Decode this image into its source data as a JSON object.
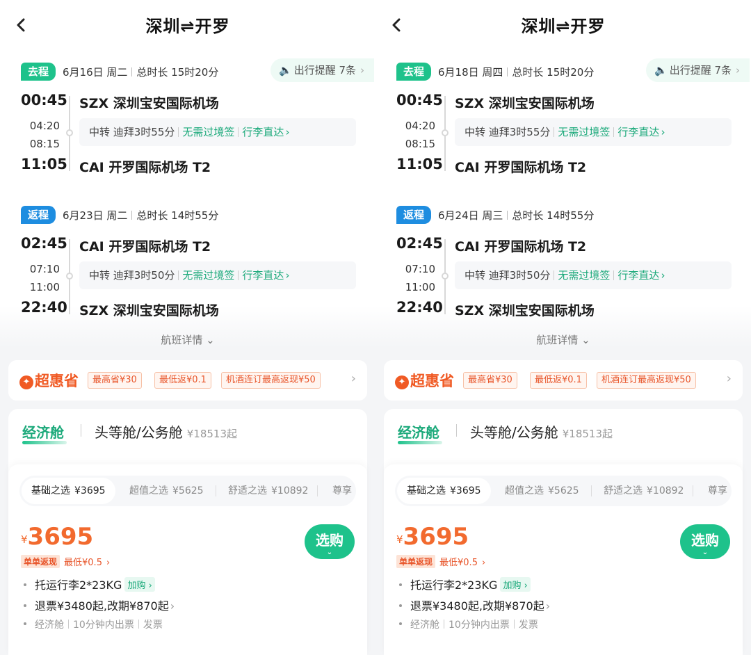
{
  "screens": [
    {
      "title": "深圳⇌开罗",
      "outbound": {
        "tag": "去程",
        "date": "6月16日 周二",
        "duration": "总时长 15时20分",
        "reminder": "出行提醒 7条",
        "dep_time": "00:45",
        "mid_arr": "04:20",
        "mid_dep": "08:15",
        "arr_time": "11:05",
        "dep_airport": "SZX 深圳宝安国际机场",
        "arr_airport": "CAI 开罗国际机场 T2",
        "transfer": "中转 迪拜3时55分",
        "visa": "无需过境签",
        "baggage": "行李直达"
      },
      "return": {
        "tag": "返程",
        "date": "6月23日 周二",
        "duration": "总时长 14时55分",
        "dep_time": "02:45",
        "mid_arr": "07:10",
        "mid_dep": "11:00",
        "arr_time": "22:40",
        "dep_airport": "CAI 开罗国际机场 T2",
        "arr_airport": "SZX 深圳宝安国际机场",
        "transfer": "中转 迪拜3时50分",
        "visa": "无需过境签",
        "baggage": "行李直达"
      },
      "flight_detail": "航班详情",
      "promo": {
        "brand": "超惠省",
        "chips": [
          "最高省¥30",
          "最低返¥0.1",
          "机酒连订最高返现¥50"
        ]
      },
      "cabin_tabs": {
        "economy": "经济舱",
        "business": "头等舱/公务舱",
        "business_price": "¥18513起"
      },
      "fares": [
        {
          "name": "基础之选",
          "price": "¥3695"
        },
        {
          "name": "超值之选",
          "price": "¥5625"
        },
        {
          "name": "舒适之选",
          "price": "¥10892"
        },
        {
          "name": "尊享",
          "price": ""
        }
      ],
      "price_symbol": "¥",
      "price": "3695",
      "cashback_badge": "单单返现",
      "cashback_text": "最低¥0.5",
      "buy_label": "选购",
      "perks": {
        "baggage": "托运行李2*23KG",
        "addon": "加购",
        "refund": "退票¥3480起,改期¥870起",
        "meta": [
          "经济舱",
          "10分钟内出票",
          "发票"
        ]
      }
    },
    {
      "title": "深圳⇌开罗",
      "outbound": {
        "tag": "去程",
        "date": "6月18日 周四",
        "duration": "总时长 15时20分",
        "reminder": "出行提醒 7条",
        "dep_time": "00:45",
        "mid_arr": "04:20",
        "mid_dep": "08:15",
        "arr_time": "11:05",
        "dep_airport": "SZX 深圳宝安国际机场",
        "arr_airport": "CAI 开罗国际机场 T2",
        "transfer": "中转 迪拜3时55分",
        "visa": "无需过境签",
        "baggage": "行李直达"
      },
      "return": {
        "tag": "返程",
        "date": "6月24日 周三",
        "duration": "总时长 14时55分",
        "dep_time": "02:45",
        "mid_arr": "07:10",
        "mid_dep": "11:00",
        "arr_time": "22:40",
        "dep_airport": "CAI 开罗国际机场 T2",
        "arr_airport": "SZX 深圳宝安国际机场",
        "transfer": "中转 迪拜3时50分",
        "visa": "无需过境签",
        "baggage": "行李直达"
      },
      "flight_detail": "航班详情",
      "promo": {
        "brand": "超惠省",
        "chips": [
          "最高省¥30",
          "最低返¥0.1",
          "机酒连订最高返现¥50"
        ]
      },
      "cabin_tabs": {
        "economy": "经济舱",
        "business": "头等舱/公务舱",
        "business_price": "¥18513起"
      },
      "fares": [
        {
          "name": "基础之选",
          "price": "¥3695"
        },
        {
          "name": "超值之选",
          "price": "¥5625"
        },
        {
          "name": "舒适之选",
          "price": "¥10892"
        },
        {
          "name": "尊享",
          "price": ""
        }
      ],
      "price_symbol": "¥",
      "price": "3695",
      "cashback_badge": "单单返现",
      "cashback_text": "最低¥0.5",
      "buy_label": "选购",
      "perks": {
        "baggage": "托运行李2*23KG",
        "addon": "加购",
        "refund": "退票¥3480起,改期¥870起",
        "meta": [
          "经济舱",
          "10分钟内出票",
          "发票"
        ]
      }
    }
  ],
  "colors": {
    "accent": "#1ec28b",
    "return_tag": "#1e8de0",
    "price": "#f26a2e"
  }
}
